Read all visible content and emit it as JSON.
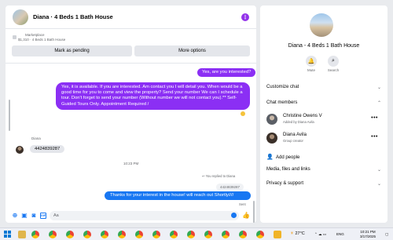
{
  "chat": {
    "title": "Diana · 4 Beds 1 Bath House",
    "menu_icon": "more-vertical-icon",
    "marketplace_label": "Marketplace",
    "listing_price": "$1,310 · 4 Beds 1 Bath House",
    "mark_pending_label": "Mark as pending",
    "more_options_label": "More options"
  },
  "messages": {
    "out_1": "Yes, are you interested?",
    "out_2": "Yes, it is available. If you are interested.  Am contact you I will detail you.  When would be a good time for you to come and view the property? Send your number We can I schedule a tour.  Don't forget to send your number (Without number we will not contact you).** Self-Guided Tours Only. Appointment Required /",
    "sender_name": "Diana",
    "in_1": "4424839287",
    "time_label": "10:23 PM",
    "reply_note": "You replied to Diana",
    "quoted": "4424839287",
    "out_3": "Thanks for your interest in the house! will reach out Shortly////",
    "seen_label": "Sent"
  },
  "composer": {
    "placeholder": "Aa",
    "plus_icon": "plus-circle-icon",
    "image_icon": "image-icon",
    "sticker_icon": "sticker-icon",
    "gif_icon": "gif-icon",
    "emoji_icon": "emoji-icon",
    "like_icon": "thumbs-up-icon"
  },
  "side": {
    "title": "Diana - 4 Beds 1 Bath House",
    "mute_label": "Mute",
    "search_label": "Search",
    "customize_chat": "Customize chat",
    "chat_members": "Chat members",
    "members": [
      {
        "name": "Christine Owens V",
        "sub": "Added by Diana Avila"
      },
      {
        "name": "Diana Avila",
        "sub": "Group creator"
      }
    ],
    "add_people": "Add people",
    "media_files_links": "Media, files and links",
    "privacy_support": "Privacy & support"
  },
  "taskbar": {
    "weather": "27°C",
    "language": "ENG",
    "time": "10:21 PM",
    "date": "3/17/2025"
  },
  "colors": {
    "accent_purple": "#8b2ff4",
    "accent_blue": "#1877f2",
    "bubble_gray": "#e4e6eb"
  }
}
